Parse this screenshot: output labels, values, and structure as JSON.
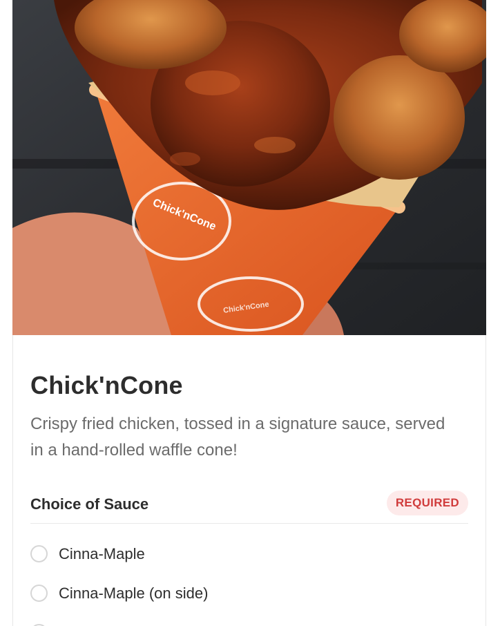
{
  "hero": {
    "cup_logo_text": "Chick'nCone",
    "cup_logo_text_lower": "Chick'nCone"
  },
  "item": {
    "title": "Chick'nCone",
    "description": "Crispy fried chicken, tossed in a signature sauce, served in a hand-rolled waffle cone!"
  },
  "section": {
    "title": "Choice of Sauce",
    "badge": "REQUIRED"
  },
  "options": [
    {
      "label": "Cinna-Maple",
      "selected": false
    },
    {
      "label": "Cinna-Maple (on side)",
      "selected": false
    }
  ],
  "colors": {
    "badge_text": "#d03b3b",
    "badge_bg": "#fdeaea",
    "cup_orange": "#e8652a"
  }
}
